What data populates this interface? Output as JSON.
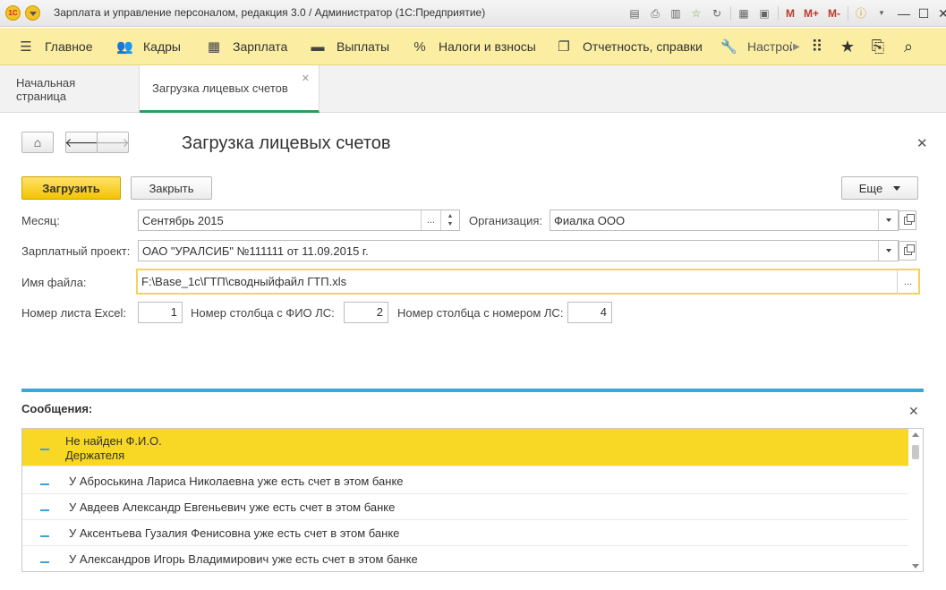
{
  "window": {
    "title": "Зарплата и управление персоналом, редакция 3.0 / Администратор  (1С:Предприятие)",
    "logo_text": "1С",
    "m_label": "M",
    "mplus_label": "M+",
    "mminus_label": "M-",
    "icons": [
      "db-icon",
      "print-icon",
      "preview-icon",
      "favorite-add-icon",
      "history-icon",
      "calculator-icon",
      "calendar-icon",
      "info-icon",
      "minimize-icon",
      "restore-icon",
      "close-icon"
    ]
  },
  "main_menu": {
    "items": [
      {
        "label": "Главное",
        "icon": "menu-icon"
      },
      {
        "label": "Кадры",
        "icon": "people-icon"
      },
      {
        "label": "Зарплата",
        "icon": "calculator-icon"
      },
      {
        "label": "Выплаты",
        "icon": "wallet-icon"
      },
      {
        "label": "Налоги и взносы",
        "icon": "percent-icon"
      },
      {
        "label": "Отчетность, справки",
        "icon": "reports-icon"
      },
      {
        "label": "Настрой",
        "icon": "wrench-icon"
      }
    ]
  },
  "tabs": [
    {
      "label": "Начальная страница"
    },
    {
      "label": "Загрузка лицевых счетов"
    }
  ],
  "form": {
    "title": "Загрузка лицевых счетов",
    "load_button": "Загрузить",
    "close_button": "Закрыть",
    "more_button": "Еще",
    "month_label": "Месяц:",
    "month_value": "Сентябрь 2015",
    "org_label": "Организация:",
    "org_value": "Фиалка ООО",
    "project_label": "Зарплатный проект:",
    "project_value": "ОАО \"УРАЛСИБ\" №111111 от 11.09.2015 г.",
    "file_label": "Имя файла:",
    "file_value": "F:\\Base_1c\\ГТП\\сводныйфайл ГТП.xls",
    "sheet_label": "Номер листа Excel:",
    "sheet_value": "1",
    "fio_col_label": "Номер столбца с ФИО ЛС:",
    "fio_col_value": "2",
    "acc_col_label": "Номер столбца с номером ЛС:",
    "acc_col_value": "4",
    "ellipsis": "..."
  },
  "messages": {
    "title": "Сообщения:",
    "items": [
      {
        "line1": "Не найден Ф.И.О.",
        "line2": "Держателя",
        "selected": true
      },
      {
        "line1": "У Аброськина Лариса Николаевна уже есть счет в этом банке",
        "selected": false
      },
      {
        "line1": "У Авдеев Александр Евгеньевич уже есть счет в этом банке",
        "selected": false
      },
      {
        "line1": "У Аксентьева Гузалия Фенисовна уже есть счет в этом банке",
        "selected": false
      },
      {
        "line1": "У Александров Игорь Владимирович уже есть счет в этом банке",
        "selected": false
      }
    ]
  },
  "colors": {
    "menu_bg": "#fbeda1",
    "primary_button": "#f4c400",
    "selected_row": "#f8d824",
    "accent_blue": "#37a8d8",
    "active_tab_underline": "#2e9b5f"
  }
}
